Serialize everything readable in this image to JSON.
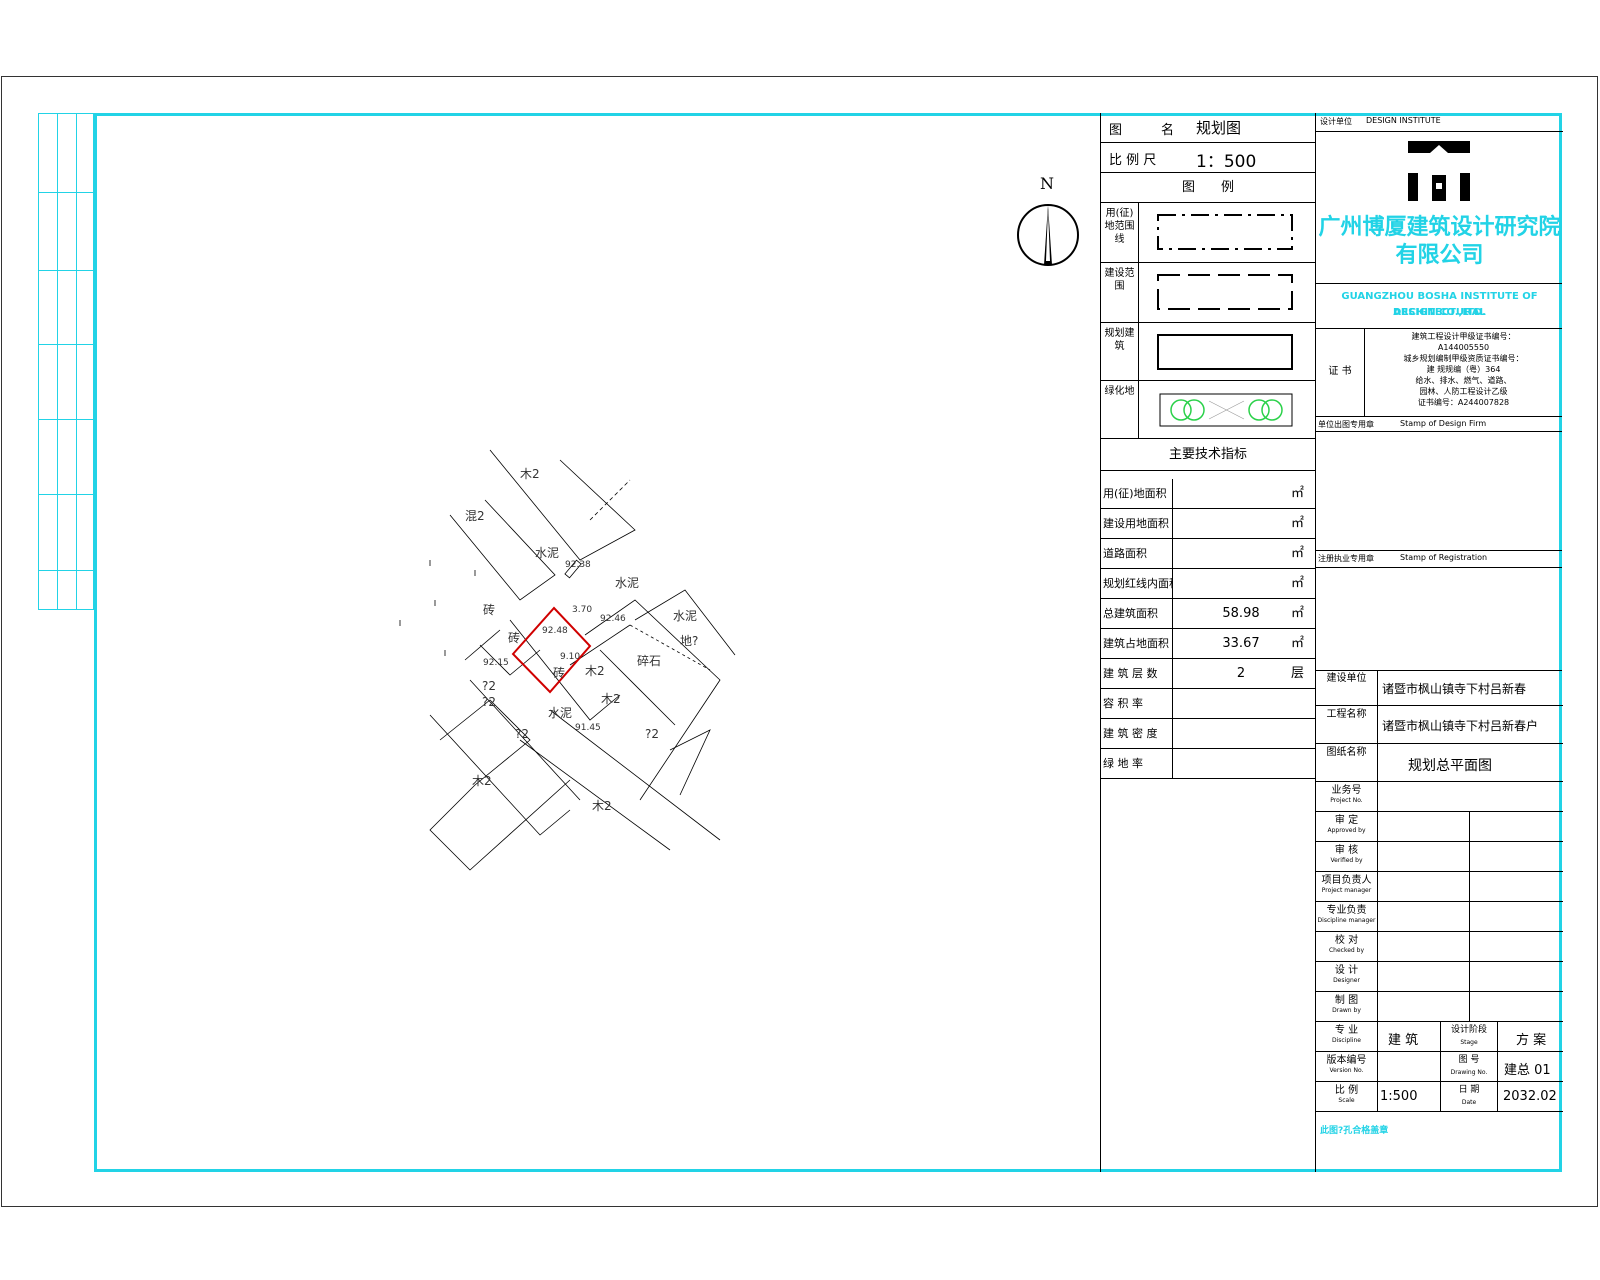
{
  "drawing": {
    "drawing_name_label": "图　　　名",
    "drawing_name": "规划图",
    "scale_label": "比  例  尺",
    "scale": "1：500",
    "legend_title": "图　　例",
    "legend_items": [
      {
        "label": "用(征)地范围线"
      },
      {
        "label": "建设范围"
      },
      {
        "label": "规划建筑"
      },
      {
        "label": "绿化地"
      }
    ],
    "indicators_title": "主要技术指标",
    "indicators": [
      {
        "label": "用(征)地面积",
        "value": "",
        "unit": "㎡"
      },
      {
        "label": "建设用地面积",
        "value": "",
        "unit": "㎡"
      },
      {
        "label": "道路面积",
        "value": "",
        "unit": "㎡"
      },
      {
        "label": "规划红线内面积",
        "value": "",
        "unit": "㎡"
      },
      {
        "label": "总建筑面积",
        "value": "58.98",
        "unit": "㎡"
      },
      {
        "label": "建筑占地面积",
        "value": "33.67",
        "unit": "㎡"
      },
      {
        "label": "建 筑 层 数",
        "value": "2",
        "unit": "层"
      },
      {
        "label": "容 积 率",
        "value": "",
        "unit": ""
      },
      {
        "label": "建 筑 密 度",
        "value": "",
        "unit": ""
      },
      {
        "label": "绿 地 率",
        "value": "",
        "unit": ""
      }
    ]
  },
  "north_label": "N",
  "site": {
    "labels": [
      "木2",
      "混2",
      "水泥",
      "92.38",
      "水泥",
      "砖",
      "砖",
      "92.46",
      "92.48",
      "3.70",
      "9.10",
      "砖",
      "92.15",
      "木2",
      "碎石",
      "?2",
      "?2",
      "木2",
      "水泥",
      "91.45",
      "?2",
      "?2",
      "木2",
      "木2",
      "地?",
      "水泥"
    ]
  },
  "title_block": {
    "design_unit_label": "设计单位",
    "design_unit_value": "DESIGN INSTITUTE",
    "company_cn_1": "广州博厦建筑设计研究院",
    "company_cn_2": "有限公司",
    "company_en_1": "GUANGZHOU BOSHA INSTITUTE OF ARCHITECTURAL",
    "company_en_2": "DESIGN CO.,LTD.",
    "cert_label": "证 书",
    "cert_lines": [
      "建筑工程设计甲级证书编号：",
      "A144005550",
      "城乡规划编制甲级资质证书编号：",
      "建 规规编（粤）364",
      "给水、排水、燃气、道路、",
      "园林、人防工程设计乙级",
      "证书编号：A244007828"
    ],
    "stamp_label": "单位出图专用章",
    "stamp_value": "Stamp of Design Firm",
    "reg_label": "注册执业专用章",
    "reg_value": "Stamp of Registration",
    "client_label": "建设单位",
    "client_value": "诸暨市枫山镇寺下村吕新春",
    "project_label": "工程名称",
    "project_value": "诸暨市枫山镇寺下村吕新春户",
    "drawing_label": "图纸名称",
    "drawing_value": "规划总平面图",
    "rows": [
      {
        "label": "业务号",
        "sub": "Project No."
      },
      {
        "label": "审 定",
        "sub": "Approved by"
      },
      {
        "label": "审 核",
        "sub": "Verified by"
      },
      {
        "label": "项目负责人",
        "sub": "Project manager"
      },
      {
        "label": "专业负责",
        "sub": "Discipline manager"
      },
      {
        "label": "校 对",
        "sub": "Checked by"
      },
      {
        "label": "设 计",
        "sub": "Designer"
      },
      {
        "label": "制 图",
        "sub": "Drawn by"
      }
    ],
    "discipline_label": "专 业",
    "discipline_sub": "Discipline",
    "discipline_value": "建 筑",
    "stage_label": "设计阶段",
    "stage_sub": "Stage",
    "stage_value": "方 案",
    "version_label": "版本编号",
    "version_sub": "Version No.",
    "version_value": "",
    "drawing_no_label": "图 号",
    "drawing_no_sub": "Drawing No.",
    "drawing_no_value": "建总 01",
    "scale_label": "比 例",
    "scale_sub": "Scale",
    "scale_value": "1:500",
    "date_label": "日 期",
    "date_sub": "Date",
    "date_value": "2032.02",
    "note": "此图?孔合格盖章"
  },
  "colors": {
    "frame": "#22d3e6",
    "highlight": "#d00000"
  }
}
